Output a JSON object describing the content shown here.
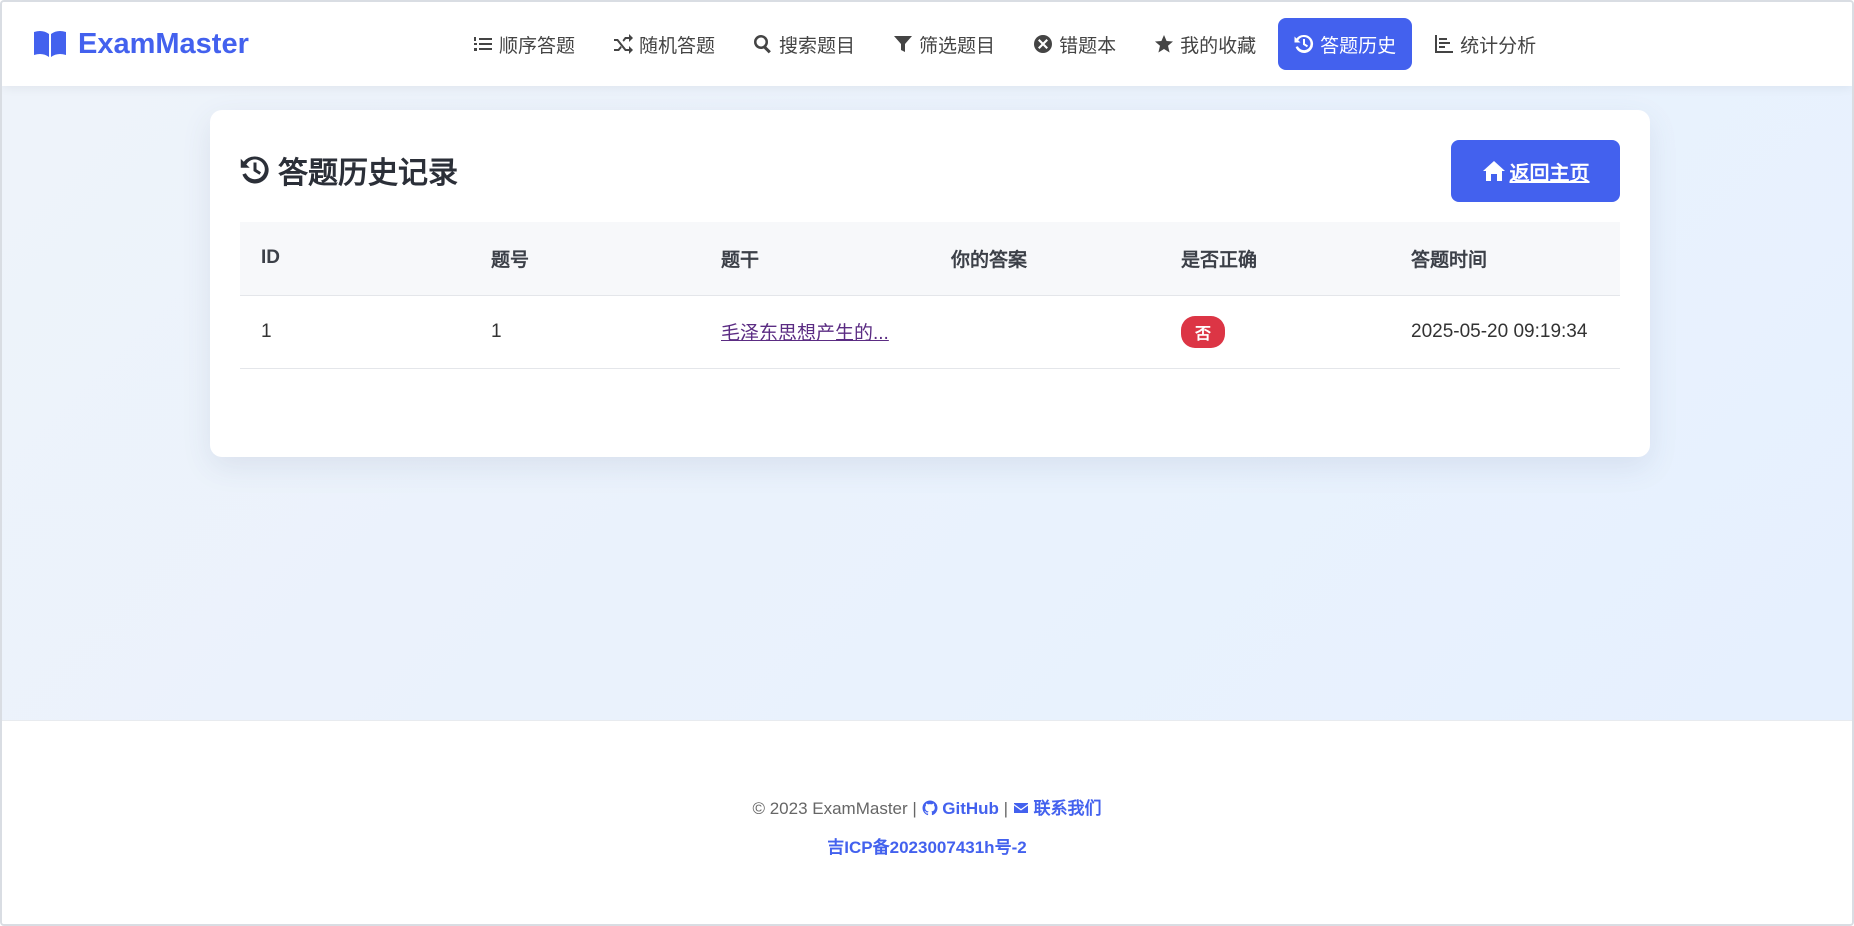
{
  "brand": {
    "name": "ExamMaster",
    "icon": "book-open-icon",
    "color": "#4361ee"
  },
  "nav": {
    "items": [
      {
        "label": "顺序答题",
        "icon": "list-ol-icon"
      },
      {
        "label": "随机答题",
        "icon": "shuffle-icon"
      },
      {
        "label": "搜索题目",
        "icon": "search-icon"
      },
      {
        "label": "筛选题目",
        "icon": "filter-icon"
      },
      {
        "label": "错题本",
        "icon": "x-circle-icon"
      },
      {
        "label": "我的收藏",
        "icon": "star-icon"
      },
      {
        "label": "答题历史",
        "icon": "history-icon",
        "active": true
      },
      {
        "label": "统计分析",
        "icon": "chart-bar-icon"
      }
    ]
  },
  "page": {
    "title": "答题历史记录",
    "title_icon": "history-icon",
    "home_button": "返回主页"
  },
  "table": {
    "headers": [
      "ID",
      "题号",
      "题干",
      "你的答案",
      "是否正确",
      "答题时间"
    ],
    "rows": [
      {
        "id": "1",
        "number": "1",
        "question": "毛泽东思想产生的...",
        "answer": "",
        "correct": "否",
        "time": "2025-05-20 09:19:34"
      }
    ]
  },
  "footer": {
    "copyright": "© 2023 ExamMaster |",
    "github": "GitHub",
    "separator": "|",
    "contact": "联系我们",
    "icp": "吉ICP备2023007431h号-2"
  },
  "colors": {
    "accent": "#4361ee",
    "danger": "#dc3545"
  }
}
